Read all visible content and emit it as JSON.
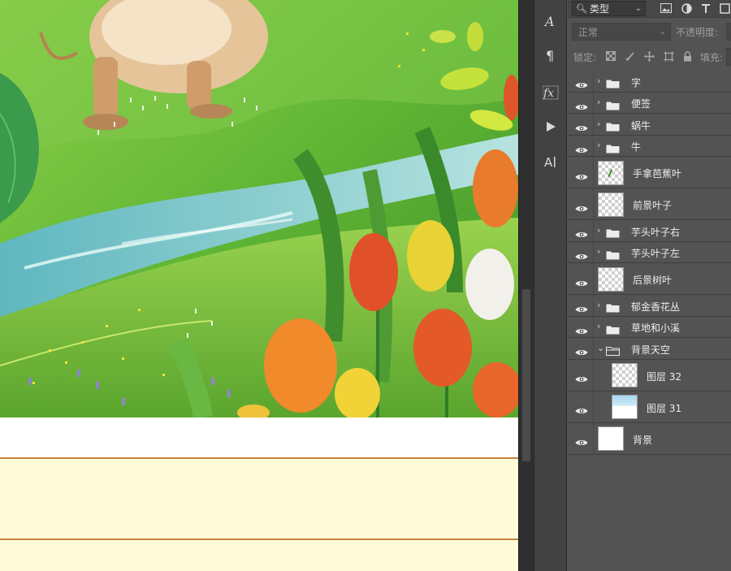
{
  "filter": {
    "kind_label": "类型",
    "icons": [
      "image-filter-icon",
      "adjustment-filter-icon",
      "type-filter-icon",
      "shape-filter-icon"
    ]
  },
  "blend": {
    "mode_label": "正常",
    "opacity_label": "不透明度:"
  },
  "lock": {
    "label": "锁定:",
    "fill_label": "填充:",
    "icons": [
      "lock-transparent-icon",
      "lock-image-icon",
      "lock-position-icon",
      "lock-artboard-icon",
      "lock-all-icon"
    ]
  },
  "tools": [
    "character-panel-icon",
    "paragraph-panel-icon",
    "layer-style-icon",
    "play-action-icon",
    "glyphs-icon"
  ],
  "layers": [
    {
      "name": "字",
      "kind": "group",
      "visible": true
    },
    {
      "name": "便签",
      "kind": "group",
      "visible": true
    },
    {
      "name": "蜗牛",
      "kind": "group",
      "visible": true
    },
    {
      "name": "牛",
      "kind": "group",
      "visible": true
    },
    {
      "name": "手拿芭蕉叶",
      "kind": "layer",
      "visible": true
    },
    {
      "name": "前景叶子",
      "kind": "layer",
      "visible": true
    },
    {
      "name": "芋头叶子右",
      "kind": "group",
      "visible": true
    },
    {
      "name": "芋头叶子左",
      "kind": "group",
      "visible": true
    },
    {
      "name": "后景树叶",
      "kind": "layer",
      "visible": true
    },
    {
      "name": "郁金香花丛",
      "kind": "group",
      "visible": true
    },
    {
      "name": "草地和小溪",
      "kind": "group",
      "visible": true
    },
    {
      "name": "背景天空",
      "kind": "group-open",
      "visible": true
    },
    {
      "name": "图层 32",
      "kind": "child-layer",
      "visible": true
    },
    {
      "name": "图层 31",
      "kind": "child-layer",
      "visible": true
    },
    {
      "name": "背景",
      "kind": "background",
      "visible": true
    }
  ],
  "colors": {
    "panel_bg": "#535353",
    "paper": "#fffbd9",
    "paper_line": "#c8823c",
    "grass": "#6cbf3a",
    "stream": "#8fcdd0"
  }
}
